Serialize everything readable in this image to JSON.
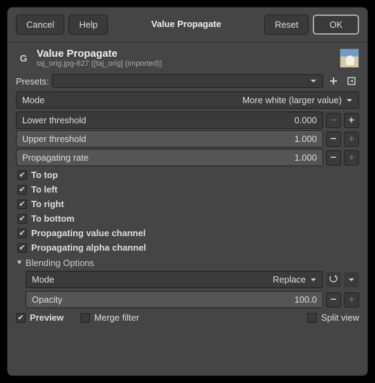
{
  "buttons": {
    "cancel": "Cancel",
    "help": "Help",
    "tab": "Value Propagate",
    "reset": "Reset",
    "ok": "OK"
  },
  "header": {
    "title": "Value Propagate",
    "subtitle": "taj_orig.jpg-627 ([taj_orig] (imported))"
  },
  "presets": {
    "label": "Presets:"
  },
  "mode": {
    "label": "Mode",
    "value": "More white (larger value)"
  },
  "sliders": {
    "lower": {
      "label": "Lower threshold",
      "value": "0.000"
    },
    "upper": {
      "label": "Upper threshold",
      "value": "1.000"
    },
    "rate": {
      "label": "Propagating rate",
      "value": "1.000"
    }
  },
  "checks": {
    "top": "To top",
    "left": "To left",
    "right": "To right",
    "bottom": "To bottom",
    "pvc": "Propagating value channel",
    "pac": "Propagating alpha channel"
  },
  "blending": {
    "header": "Blending Options",
    "mode_label": "Mode",
    "mode_value": "Replace",
    "opacity_label": "Opacity",
    "opacity_value": "100.0"
  },
  "footer": {
    "preview": "Preview",
    "merge": "Merge filter",
    "split": "Split view"
  }
}
